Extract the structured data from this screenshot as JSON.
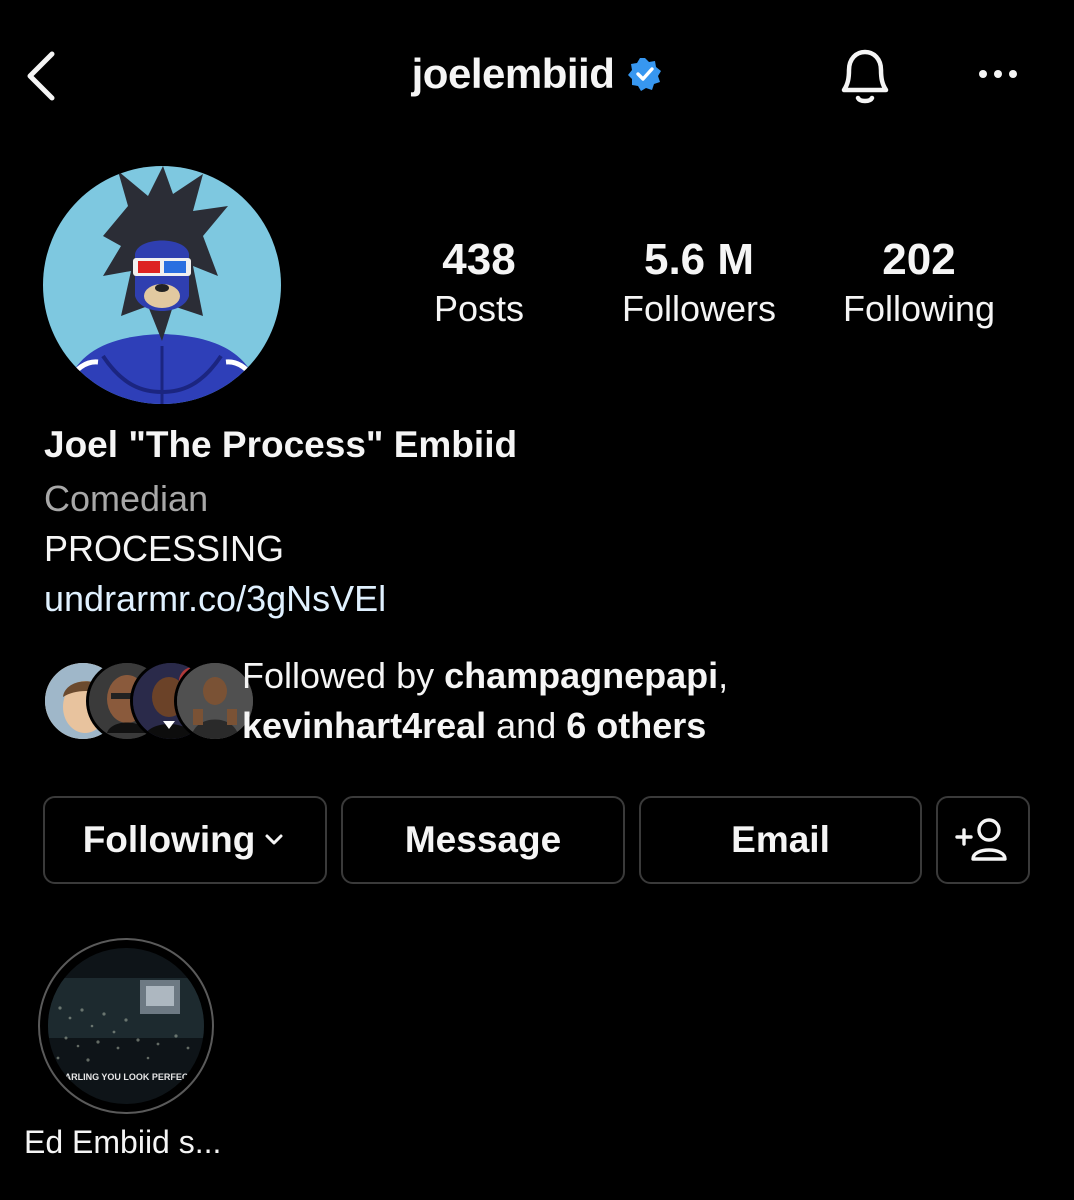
{
  "header": {
    "username": "joelembiid",
    "verified_icon": "verified-badge-icon",
    "back_icon": "chevron-left-icon",
    "bell_icon": "bell-icon",
    "more_icon": "more-horizontal-icon",
    "verified_color": "#3797f0"
  },
  "stats": [
    {
      "value": "438",
      "label": "Posts"
    },
    {
      "value": "5.6 M",
      "label": "Followers"
    },
    {
      "value": "202",
      "label": "Following"
    }
  ],
  "bio": {
    "name": "Joel \"The Process\" Embiid",
    "category": "Comedian",
    "text": "PROCESSING",
    "link": "undrarmr.co/3gNsVEl"
  },
  "followed_by": {
    "prefix": "Followed by ",
    "user1": "champagnepapi",
    "comma": ",",
    "user2": "kevinhart4real",
    "and": " and ",
    "others": "6 others"
  },
  "buttons": {
    "following": "Following",
    "message": "Message",
    "email": "Email",
    "add_user_icon": "add-person-icon"
  },
  "highlights": [
    {
      "label": "Ed Embiid s...",
      "overlay_text": "DARLING YOU LOOK PERFECT"
    }
  ]
}
